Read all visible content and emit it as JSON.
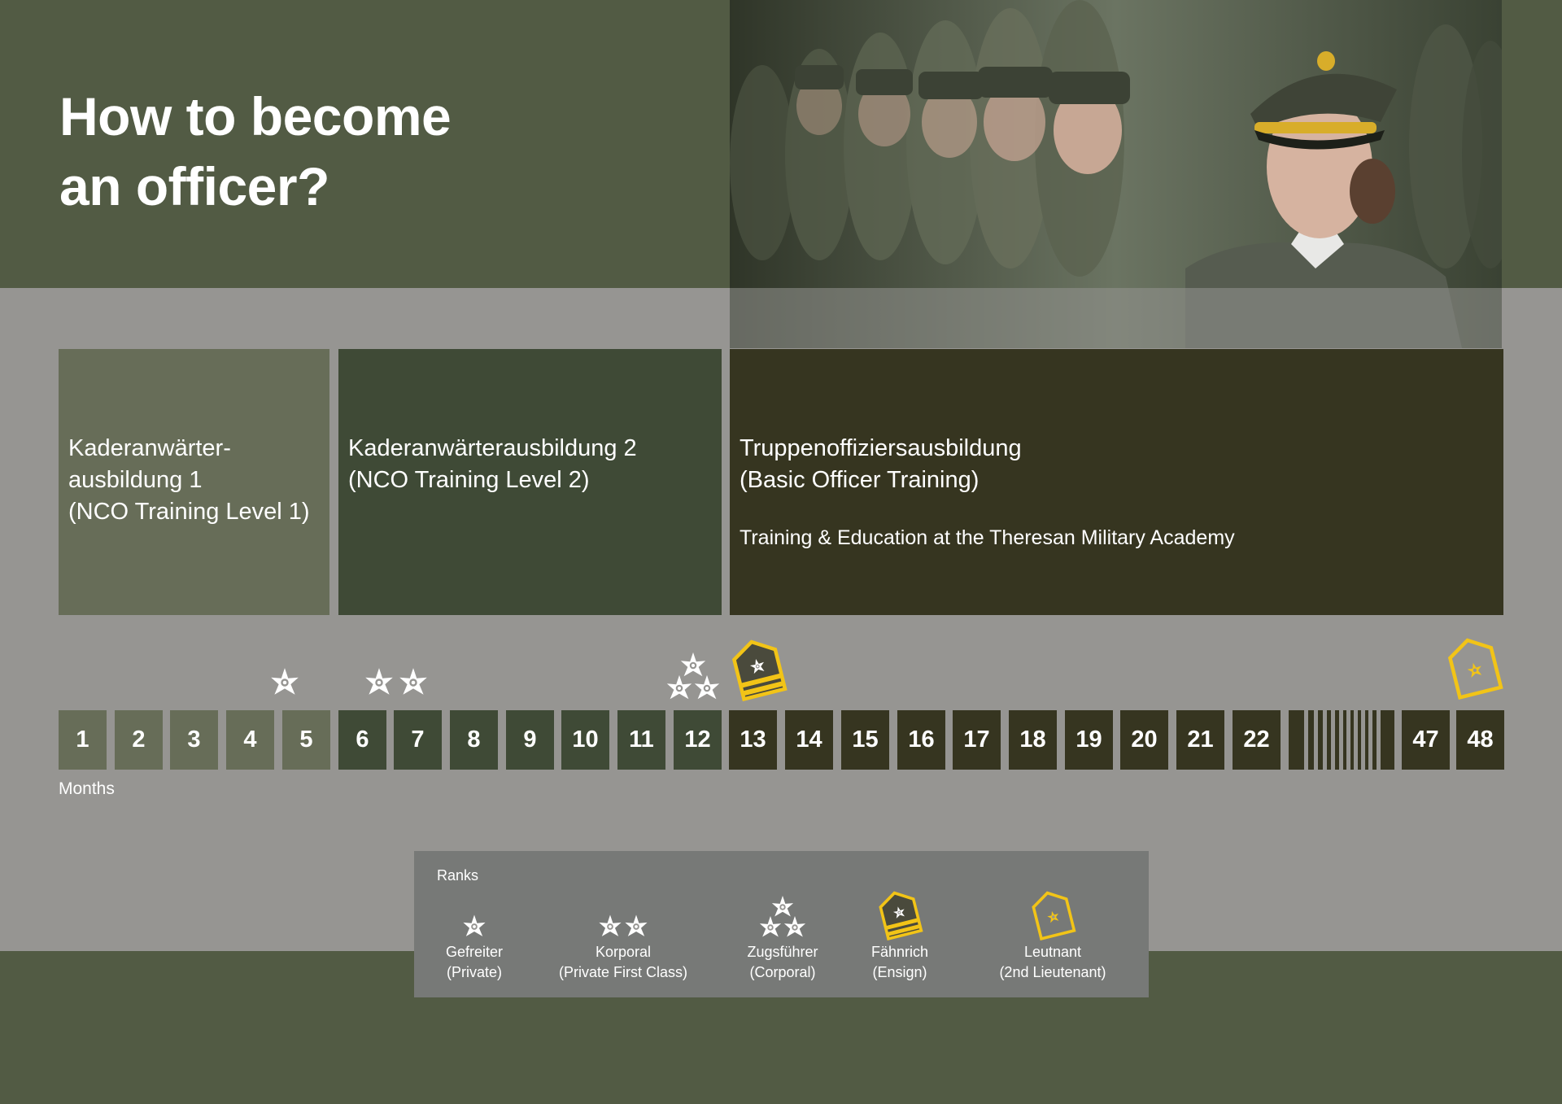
{
  "title": {
    "line1": "How to become",
    "line2": "an officer?"
  },
  "photo": {
    "description": "photo-soldiers-lineup"
  },
  "phases": [
    {
      "lines": [
        "Kaderanwärter-",
        "ausbildung 1",
        "(NCO Training Level 1)"
      ]
    },
    {
      "lines": [
        "Kaderanwärterausbildung 2",
        "(NCO Training Level 2)"
      ]
    },
    {
      "lines": [
        "Truppenoffiziersausbildung",
        "(Basic Officer Training)"
      ],
      "subtitle": "Training & Education at the Theresan Military Academy"
    }
  ],
  "timeline": {
    "months": [
      "1",
      "2",
      "3",
      "4",
      "5",
      "6",
      "7",
      "8",
      "9",
      "10",
      "11",
      "12",
      "13",
      "14",
      "15",
      "16",
      "17",
      "18",
      "19",
      "20",
      "21",
      "22",
      "47",
      "48"
    ],
    "axis_label": "Months"
  },
  "legend": {
    "title": "Ranks",
    "items": [
      {
        "name": "Gefreiter",
        "translation": "(Private)"
      },
      {
        "name": "Korporal",
        "translation": "(Private First Class)"
      },
      {
        "name": "Zugsführer",
        "translation": "(Corporal)"
      },
      {
        "name": "Fähnrich",
        "translation": "(Ensign)"
      },
      {
        "name": "Leutnant",
        "translation": "(2nd Lieutenant)"
      }
    ]
  },
  "colors": {
    "olive_band": "#525b44",
    "grey_band": "#969592",
    "phase1": "#676d58",
    "phase2": "#3f4a36",
    "phase3": "#363520",
    "insignia_gold": "#f2c417",
    "legend_bg": "#777977"
  }
}
